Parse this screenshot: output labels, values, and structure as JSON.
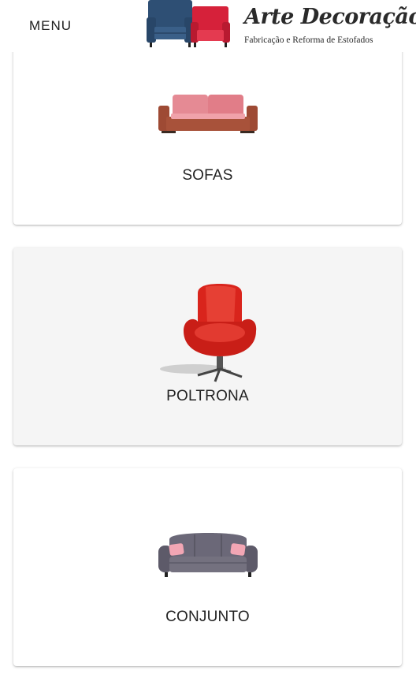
{
  "header": {
    "menu_label": "MENU",
    "logo": {
      "title": "Arte Decoração",
      "subtitle": "Fabricação e Reforma de Estofados",
      "icon": "two-armchairs-logo-icon"
    }
  },
  "categories": [
    {
      "label": "SOFAS",
      "icon": "sofa-icon"
    },
    {
      "label": "POLTRONA",
      "icon": "armchair-icon"
    },
    {
      "label": "CONJUNTO",
      "icon": "sofa-set-icon"
    }
  ],
  "colors": {
    "logo_blue": "#2e4f74",
    "logo_red": "#d6213a",
    "sofa_frame": "#9e4a34",
    "sofa_cushion": "#e58a94",
    "armchair_red": "#d9241c",
    "set_gray": "#6b6878",
    "pillow_pink": "#f2a6b4",
    "card_alt_bg": "#f5f5f5"
  }
}
